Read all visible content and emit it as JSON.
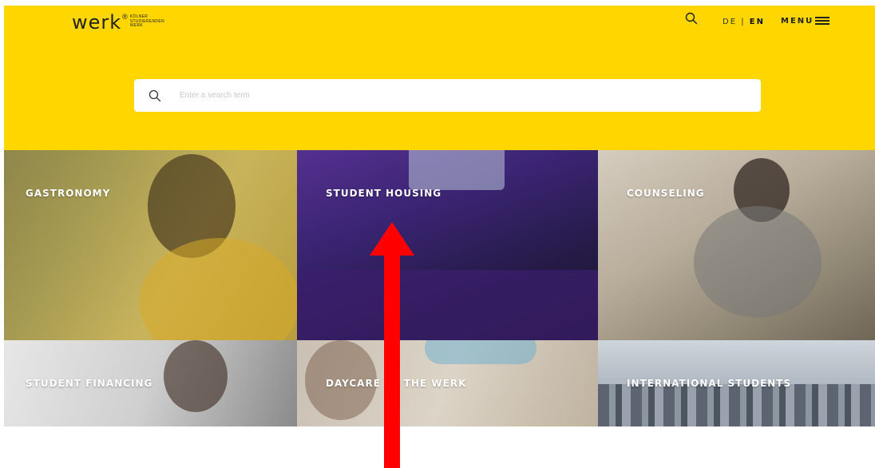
{
  "header": {
    "logo_text": "werk",
    "logo_mark": "®",
    "logo_sub": [
      "KÖLNER",
      "STUDIERENDEN",
      "WERK"
    ],
    "lang_de": "DE",
    "lang_sep": "|",
    "lang_en": "EN",
    "menu_label": "MENU",
    "search_icon": "search-icon",
    "menu_icon": "hamburger-icon"
  },
  "search": {
    "placeholder": "Enter a search term",
    "icon": "search-icon"
  },
  "tiles": [
    {
      "label": "GASTRONOMY"
    },
    {
      "label": "STUDENT HOUSING"
    },
    {
      "label": "COUNSELING"
    },
    {
      "label": "STUDENT FINANCING"
    },
    {
      "label": "DAYCARE AT THE WERK"
    },
    {
      "label": "INTERNATIONAL STUDENTS"
    }
  ],
  "annotation": {
    "type": "arrow",
    "color": "#ff0000",
    "points_to": "tile-student-housing"
  },
  "colors": {
    "brand_yellow": "#ffd600",
    "text_dark": "#222222",
    "arrow_red": "#ff0000"
  }
}
